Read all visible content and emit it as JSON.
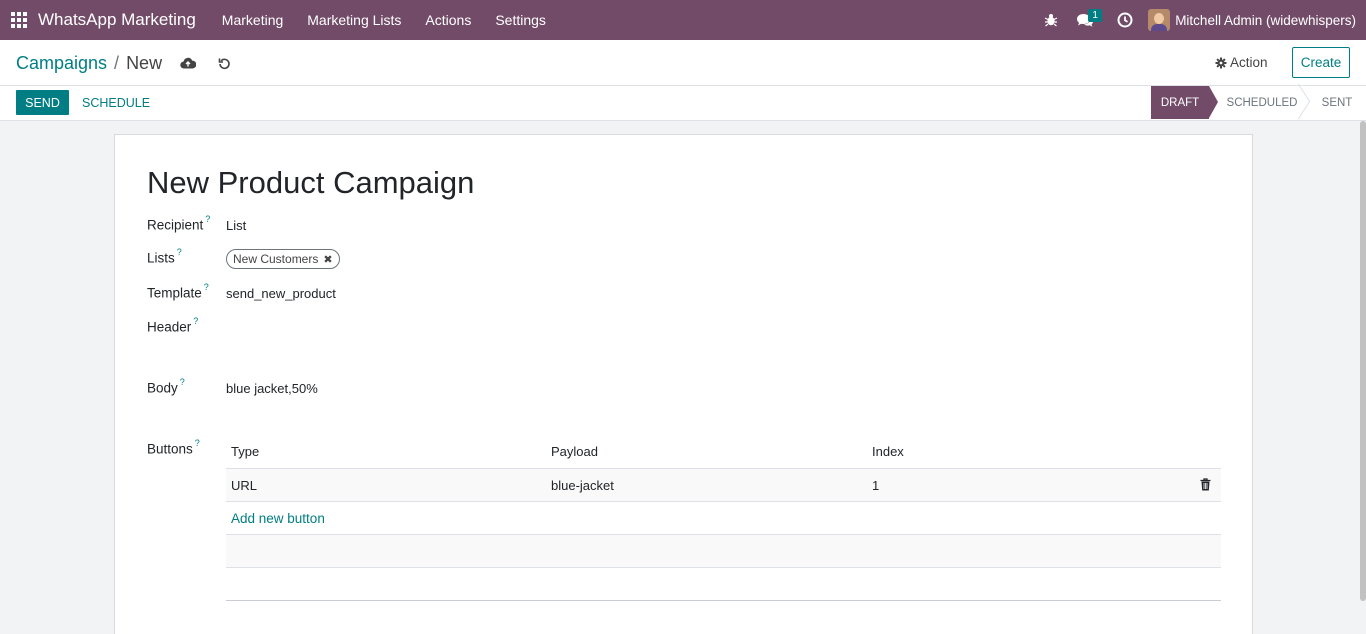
{
  "navbar": {
    "brand": "WhatsApp Marketing",
    "menus": [
      "Marketing",
      "Marketing Lists",
      "Actions",
      "Settings"
    ],
    "messages_count": "1",
    "user": "Mitchell Admin (widewhispers)",
    "icons": [
      "apps-icon",
      "bug-icon",
      "chat-icon",
      "clock-icon",
      "avatar"
    ]
  },
  "control": {
    "breadcrumb_parent": "Campaigns",
    "breadcrumb_separator": "/",
    "breadcrumb_current": "New",
    "action_label": "Action",
    "create_label": "Create"
  },
  "statusbar": {
    "send_label": "SEND",
    "schedule_label": "SCHEDULE",
    "stages": [
      "DRAFT",
      "SCHEDULED",
      "SENT"
    ],
    "active_stage": "DRAFT"
  },
  "form": {
    "title": "New Product Campaign",
    "fields": {
      "recipient": {
        "label": "Recipient",
        "value": "List"
      },
      "lists": {
        "label": "Lists",
        "tags": [
          "New Customers"
        ]
      },
      "template": {
        "label": "Template",
        "value": "send_new_product"
      },
      "header": {
        "label": "Header",
        "value": ""
      },
      "body": {
        "label": "Body",
        "value": "blue jacket,50%"
      },
      "buttons": {
        "label": "Buttons"
      }
    },
    "help_marker": "?",
    "buttons_table": {
      "columns": [
        "Type",
        "Payload",
        "Index"
      ],
      "rows": [
        {
          "type": "URL",
          "payload": "blue-jacket",
          "index": "1"
        }
      ],
      "add_label": "Add new button"
    }
  },
  "colors": {
    "navbar": "#714b67",
    "primary": "#017e84"
  }
}
